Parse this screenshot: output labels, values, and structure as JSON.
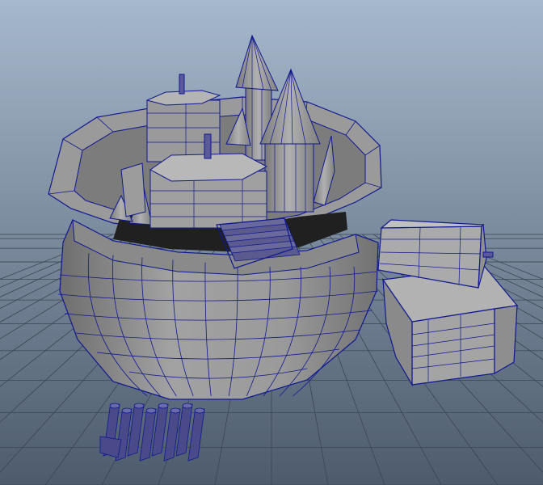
{
  "viewport": {
    "kind": "3d-modeling-viewport",
    "render_mode": "smooth-shaded-with-wireframe",
    "background_top": "#a6b8cc",
    "background_bottom": "#4d5b6c",
    "grid_color": "#3a4656",
    "wire_color": "#101890",
    "surface_light": "#a8a8a8",
    "surface_mid": "#8c8c8c",
    "surface_dark": "#707070",
    "interior_color": "#202020"
  },
  "scene_objects": [
    {
      "id": "sack",
      "icon": "sack-mesh"
    },
    {
      "id": "tower-left",
      "icon": "cone-tower-mesh"
    },
    {
      "id": "tower-center",
      "icon": "cone-tower-mesh"
    },
    {
      "id": "tower-right",
      "icon": "cone-tower-mesh"
    },
    {
      "id": "box-back",
      "icon": "hex-box-mesh"
    },
    {
      "id": "box-front",
      "icon": "hex-box-mesh"
    },
    {
      "id": "firecracker-bundle",
      "icon": "cylinder-bundle-mesh"
    },
    {
      "id": "chest",
      "icon": "chest-mesh"
    },
    {
      "id": "firecrackers-ground",
      "icon": "cylinder-row-mesh"
    }
  ]
}
